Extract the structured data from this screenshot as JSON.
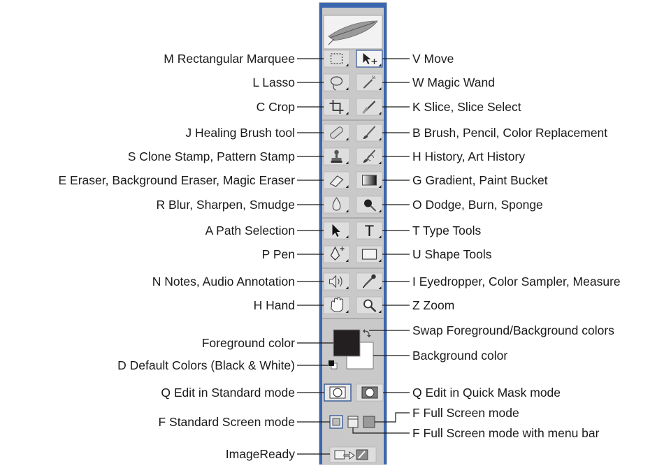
{
  "palette": {
    "panel_bg": "#c9c9c9",
    "panel_edge": "#3b67b0",
    "button_face": "#dedede",
    "selected_face": "#f4f4f4",
    "foreground_swatch": "#231f20",
    "background_swatch": "#ffffff",
    "leader_line": "#1a1a1a"
  },
  "panel": {
    "logo_icon": "feather-icon"
  },
  "tool_rows": [
    {
      "left_icon": "rectangular-marquee-icon",
      "right_icon": "move-icon",
      "left_label": "M Rectangular Marquee",
      "right_label": "V Move"
    },
    {
      "left_icon": "lasso-icon",
      "right_icon": "magic-wand-icon",
      "left_label": "L Lasso",
      "right_label": "W Magic Wand"
    },
    {
      "left_icon": "crop-icon",
      "right_icon": "slice-icon",
      "left_label": "C Crop",
      "right_label": "K Slice, Slice Select"
    },
    {
      "left_icon": "healing-brush-icon",
      "right_icon": "brush-icon",
      "left_label": "J Healing Brush tool",
      "right_label": "B Brush, Pencil, Color Replacement"
    },
    {
      "left_icon": "clone-stamp-icon",
      "right_icon": "history-brush-icon",
      "left_label": "S Clone Stamp, Pattern Stamp",
      "right_label": "H History, Art History"
    },
    {
      "left_icon": "eraser-icon",
      "right_icon": "gradient-icon",
      "left_label": "E Eraser, Background Eraser, Magic Eraser",
      "right_label": "G Gradient, Paint Bucket"
    },
    {
      "left_icon": "blur-icon",
      "right_icon": "dodge-icon",
      "left_label": "R Blur, Sharpen, Smudge",
      "right_label": "O Dodge, Burn, Sponge"
    },
    {
      "left_icon": "path-selection-icon",
      "right_icon": "type-icon",
      "left_label": "A Path Selection",
      "right_label": "T Type Tools"
    },
    {
      "left_icon": "pen-icon",
      "right_icon": "shape-icon",
      "left_label": "P Pen",
      "right_label": "U Shape Tools"
    },
    {
      "left_icon": "notes-icon",
      "right_icon": "eyedropper-icon",
      "left_label": "N Notes, Audio Annotation",
      "right_label": "I Eyedropper, Color Sampler, Measure"
    },
    {
      "left_icon": "hand-icon",
      "right_icon": "zoom-icon",
      "left_label": "H Hand",
      "right_label": "Z Zoom"
    }
  ],
  "colors_section": {
    "foreground_label": "Foreground color",
    "background_label": "Background color",
    "swap_label": "Swap Foreground/Background colors",
    "default_label": "D Default Colors (Black & White)",
    "swap_icon": "swap-arrows-icon",
    "default_icon": "default-colors-icon"
  },
  "modes_section": {
    "standard_mode_label": "Q Edit in Standard mode",
    "quick_mask_label": "Q Edit in Quick Mask mode"
  },
  "screen_section": {
    "standard_screen_label": "F Standard Screen mode",
    "full_screen_label": "F Full Screen mode",
    "full_screen_menu_label": "F Full Screen mode with menu bar"
  },
  "imageready_section": {
    "label": "ImageReady",
    "icon": "jump-to-imageready-icon"
  }
}
